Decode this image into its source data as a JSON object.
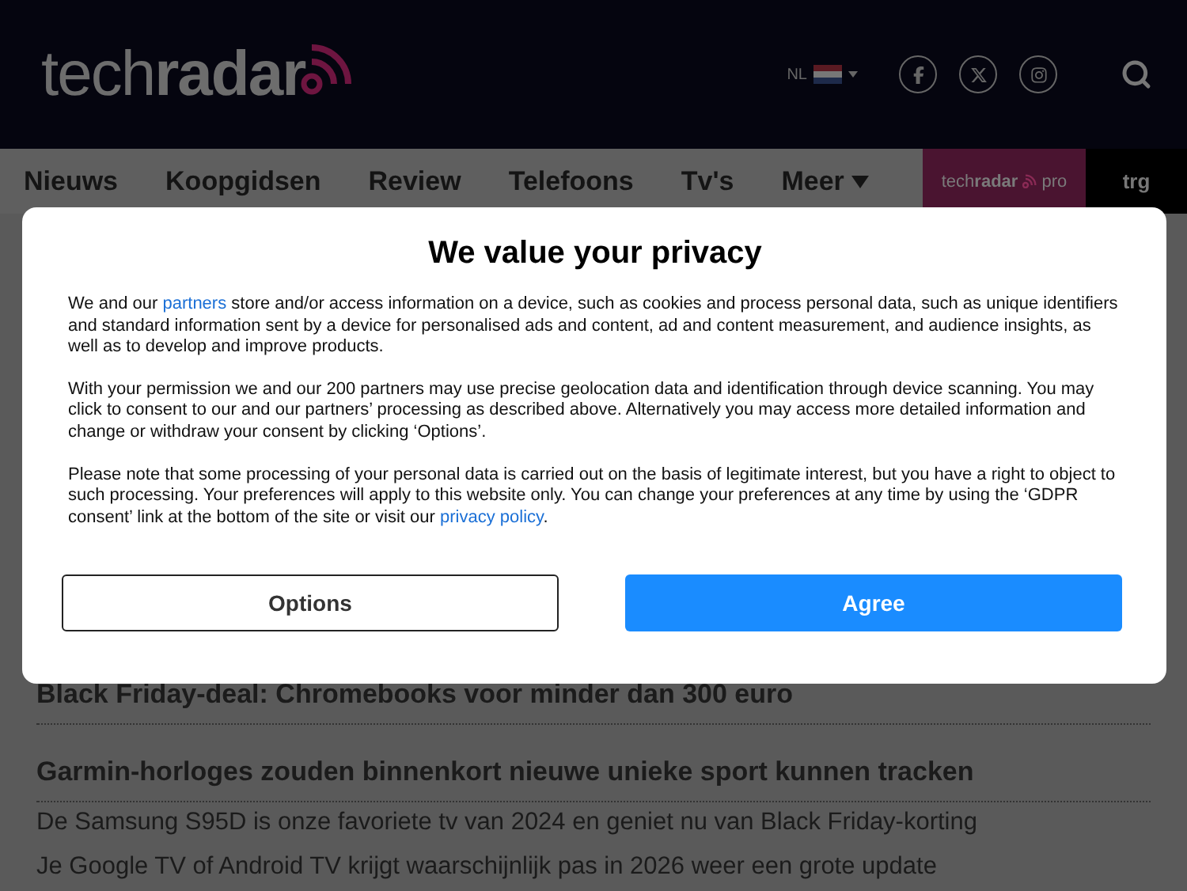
{
  "header": {
    "logo": {
      "part_1": "tech",
      "part_2": "radar"
    },
    "language": "NL",
    "social": [
      {
        "kind": "facebook"
      },
      {
        "kind": "x"
      },
      {
        "kind": "instagram"
      }
    ]
  },
  "nav": {
    "items": [
      {
        "label": "Nieuws",
        "dropdown": false
      },
      {
        "label": "Koopgidsen",
        "dropdown": false
      },
      {
        "label": "Review",
        "dropdown": false
      },
      {
        "label": "Telefoons",
        "dropdown": false
      },
      {
        "label": "Tv's",
        "dropdown": false
      },
      {
        "label": "Meer",
        "dropdown": true
      }
    ],
    "brands": [
      {
        "kind": "pro",
        "part_1": "tech",
        "part_2": "radar",
        "part_3": "pro"
      },
      {
        "kind": "trg",
        "part_1": "trg"
      }
    ]
  },
  "articles": [
    {
      "title": "Black Friday-deal: Chromebooks voor minder dan 300 euro",
      "kind": "headline"
    },
    {
      "title": "Garmin-horloges zouden binnenkort nieuwe unieke sport kunnen tracken",
      "kind": "headline"
    },
    {
      "title": "De Samsung S95D is onze favoriete tv van 2024 en geniet nu van Black Friday-korting",
      "kind": "link"
    },
    {
      "title": "Je Google TV of Android TV krijgt waarschijnlijk pas in 2026 weer een grote update",
      "kind": "link"
    }
  ],
  "consent_dialog": {
    "title": "We value your privacy",
    "paragraphs": [
      [
        {
          "text": "We and our "
        },
        {
          "text": "partners",
          "link": true
        },
        {
          "text": " store and/or access information on a device, such as cookies and process personal data, such as unique identifiers and standard information sent by a device for personalised ads and content, ad and content measurement, and audience insights, as well as to develop and improve products."
        }
      ],
      [
        {
          "text": "With your permission we and our 200 partners may use precise geolocation data and identification through device scanning. You may click to consent to our and our partners’ processing as described above. Alternatively you may access more detailed information and change or withdraw your consent by clicking ‘Options’."
        }
      ],
      [
        {
          "text": "Please note that some processing of your personal data is carried out on the basis of legitimate interest, but you have a right to object to such processing. Your preferences will apply to this website only. You can change your preferences at any time by using the ‘GDPR consent’ link at the bottom of the site or visit our "
        },
        {
          "text": "privacy policy",
          "link": true
        },
        {
          "text": "."
        }
      ]
    ],
    "buttons": [
      {
        "label": "Options",
        "kind": "secondary"
      },
      {
        "label": "Agree",
        "kind": "primary"
      }
    ]
  }
}
